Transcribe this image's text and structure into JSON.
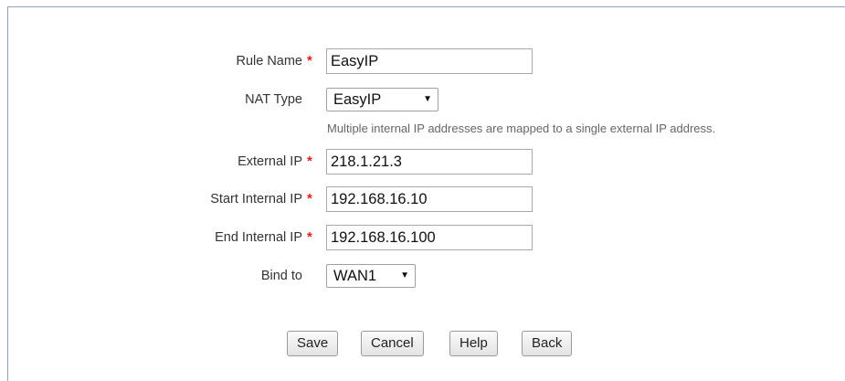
{
  "form": {
    "rule_name": {
      "label": "Rule Name",
      "required_mark": "*",
      "value": "EasyIP"
    },
    "nat_type": {
      "label": "NAT Type",
      "selected": "EasyIP",
      "hint": "Multiple internal IP addresses are mapped to a single external IP address."
    },
    "external_ip": {
      "label": "External IP",
      "required_mark": "*",
      "value": "218.1.21.3"
    },
    "start_internal_ip": {
      "label": "Start Internal IP",
      "required_mark": "*",
      "value": "192.168.16.10"
    },
    "end_internal_ip": {
      "label": "End Internal IP",
      "required_mark": "*",
      "value": "192.168.16.100"
    },
    "bind_to": {
      "label": "Bind to",
      "selected": "WAN1"
    }
  },
  "buttons": {
    "save": "Save",
    "cancel": "Cancel",
    "help": "Help",
    "back": "Back"
  },
  "icons": {
    "dropdown": "triangle-down-icon"
  },
  "colors": {
    "required": "#e02020",
    "panel_border": "#8fa1b3",
    "hint_text": "#666666"
  }
}
